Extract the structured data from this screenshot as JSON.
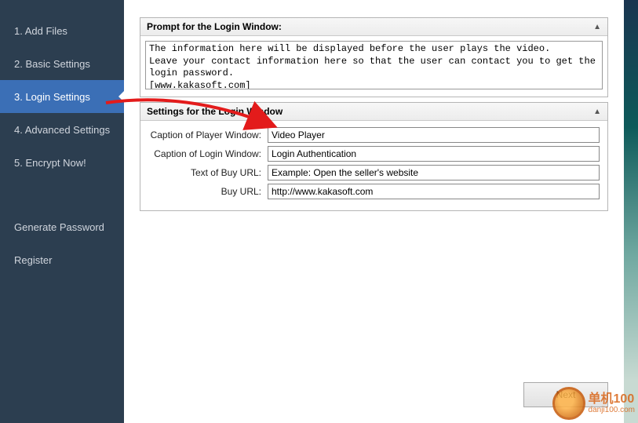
{
  "sidebar": {
    "items": [
      {
        "label": "1. Add Files"
      },
      {
        "label": "2. Basic Settings"
      },
      {
        "label": "3. Login Settings"
      },
      {
        "label": "4. Advanced Settings"
      },
      {
        "label": "5. Encrypt Now!"
      }
    ],
    "extra": [
      {
        "label": "Generate Password"
      },
      {
        "label": "Register"
      }
    ]
  },
  "panels": {
    "prompt": {
      "title": "Prompt for the Login Window:",
      "text": "The information here will be displayed before the user plays the video.\nLeave your contact information here so that the user can contact you to get the login password.\n[www.kakasoft.com]"
    },
    "settings": {
      "title": "Settings for the Login Window",
      "rows": {
        "caption_player": {
          "label": "Caption of Player Window:",
          "value": "Video Player"
        },
        "caption_login": {
          "label": "Caption of Login Window:",
          "value": "Login Authentication"
        },
        "buy_text": {
          "label": "Text of Buy URL:",
          "value": "Example: Open the seller's website"
        },
        "buy_url": {
          "label": "Buy URL:",
          "value": "http://www.kakasoft.com"
        }
      }
    }
  },
  "footer": {
    "next": "Next"
  },
  "watermark": {
    "line1": "单机100",
    "line2": "danji100.com"
  }
}
